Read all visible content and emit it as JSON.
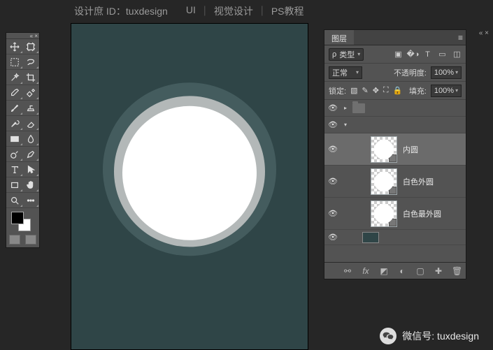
{
  "header": {
    "brand": "设计庶 ID：tuxdesign",
    "nav": [
      "UI",
      "视觉设计",
      "PS教程"
    ]
  },
  "tools": {
    "items": [
      "move-tool",
      "artboard-tool",
      "rect-marquee-tool",
      "lasso-tool",
      "magic-wand-tool",
      "crop-tool",
      "eyedropper-tool",
      "spot-heal-tool",
      "brush-tool",
      "clone-stamp-tool",
      "history-brush-tool",
      "eraser-tool",
      "gradient-tool",
      "blur-tool",
      "dodge-tool",
      "pen-tool",
      "type-tool",
      "path-select-tool",
      "rectangle-tool",
      "hand-tool",
      "zoom-tool",
      "edit-toolbar"
    ]
  },
  "canvas": {
    "bg_color": "#2f4547",
    "outer_color": "#445c5e",
    "mid_color": "#b3b8b8",
    "inner_color": "#ffffff"
  },
  "layers_panel": {
    "tab": "图层",
    "filter_prefix": "ρ",
    "filter_label": "类型",
    "blend_mode": "正常",
    "opacity_label": "不透明度:",
    "opacity_value": "100%",
    "lock_label": "锁定:",
    "fill_label": "填充:",
    "fill_value": "100%",
    "layers": [
      {
        "name": "内圆",
        "selected": true
      },
      {
        "name": "白色外圆",
        "selected": false
      },
      {
        "name": "白色最外圆",
        "selected": false
      }
    ]
  },
  "footer": {
    "wechat_label": "微信号: tuxdesign"
  }
}
